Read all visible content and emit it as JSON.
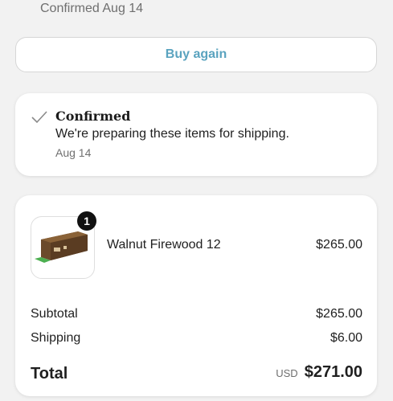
{
  "header": {
    "status_line": "Confirmed Aug 14"
  },
  "actions": {
    "buy_again_label": "Buy again"
  },
  "status_card": {
    "title": "Confirmed",
    "description": "We're preparing these items for shipping.",
    "date": "Aug 14",
    "icon": "checkmark-icon"
  },
  "order": {
    "item": {
      "quantity": "1",
      "name": "Walnut Firewood 12",
      "price": "$265.00"
    },
    "subtotal_label": "Subtotal",
    "subtotal_value": "$265.00",
    "shipping_label": "Shipping",
    "shipping_value": "$6.00",
    "total_label": "Total",
    "currency": "USD",
    "total_value": "$271.00"
  },
  "colors": {
    "accent": "#5aa3bf",
    "background": "#f2f2f2",
    "badge": "#111111"
  }
}
